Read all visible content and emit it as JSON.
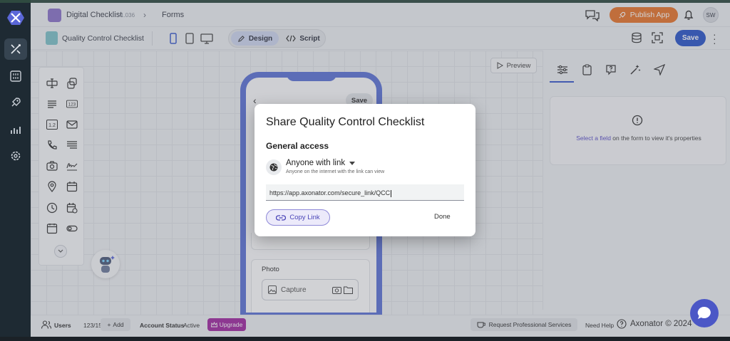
{
  "header": {
    "app_name": "Digital Checklist",
    "app_version": "v1.036",
    "breadcrumb_sep": "›",
    "breadcrumb_current": "Forms",
    "publish_label": "Publish App",
    "avatar_initials": "SW"
  },
  "toolbar": {
    "form_name": "Quality Control Checklist",
    "design_label": "Design",
    "script_label": "Script",
    "save_label": "Save"
  },
  "canvas": {
    "preview_label": "Preview",
    "phone_save_label": "Save",
    "photo_label": "Photo",
    "capture_label": "Capture"
  },
  "right_panel": {
    "prop_link": "Select a field",
    "prop_text": " on the form to view it's properties"
  },
  "footer": {
    "users_label": "Users",
    "users_count": "123/150",
    "add_label": "Add",
    "account_status_label": "Account Status",
    "account_status_value": "Active",
    "upgrade_label": "Upgrade",
    "request_label": "Request Professional Services",
    "need_help_label": "Need Help",
    "copyright": "Axonator © 2024"
  },
  "dialog": {
    "title": "Share Quality Control Checklist",
    "section_label": "General access",
    "access_mode": "Anyone with link",
    "access_desc": "Anyone on the internet with the link can view",
    "link_value": "https://app.axonator.com/secure_link/QCC",
    "copy_label": "Copy Link",
    "done_label": "Done"
  },
  "colors": {
    "sidebar": "#1e2a33",
    "accent": "#2c57c9",
    "publish": "#e8752c",
    "upgrade": "#a12aa1",
    "chat": "#4b57c6"
  }
}
